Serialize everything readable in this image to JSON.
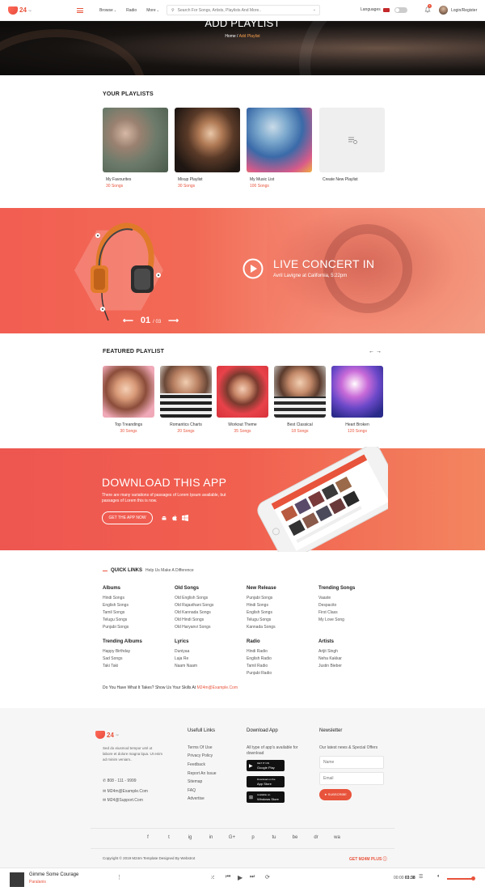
{
  "header": {
    "logo_text": "24",
    "logo_sub": "mp",
    "nav": [
      "Browse",
      "Radio",
      "More"
    ],
    "search_placeholder": "Search For Songs, Artists, Playlists And More..",
    "language_label": "Languages",
    "notification_count": "2",
    "login_label": "Login/Register"
  },
  "hero": {
    "title": "ADD PLAYLIST",
    "breadcrumb_home": "Home",
    "breadcrumb_sep": "/",
    "breadcrumb_current": "Add Playlist"
  },
  "your_playlists": {
    "heading": "YOUR PLAYLISTS",
    "items": [
      {
        "name": "My Favourites",
        "count": "30 Songs"
      },
      {
        "name": "Mixup Playlist",
        "count": "30 Songs"
      },
      {
        "name": "My Music List",
        "count": "100 Songs"
      },
      {
        "name": "Create New Playlist",
        "count": ""
      }
    ]
  },
  "concert": {
    "title": "LIVE CONCERT IN",
    "subtitle": "Avril Lavigne at California, 5:22pm",
    "slide_current": "01",
    "slide_total": "/ 03"
  },
  "featured": {
    "heading": "FEATURED PLAYLIST",
    "items": [
      {
        "name": "Top Treandings",
        "count": "30 Songs"
      },
      {
        "name": "Romantics Charts",
        "count": "20 Songs"
      },
      {
        "name": "Workout Theme",
        "count": "35 Songs"
      },
      {
        "name": "Best Classical",
        "count": "18 Songs"
      },
      {
        "name": "Heart Broken",
        "count": "120 Songs"
      }
    ]
  },
  "download": {
    "title": "DOWNLOAD THIS APP",
    "text": "There are many variations of passages of Lorem Ipsum available, but passages of Lorem this is now.",
    "button": "GET THE APP NOW"
  },
  "quick_links": {
    "title": "QUICK LINKS",
    "desc": "Help Us Make A Difference",
    "columns": [
      {
        "title": "Albums",
        "links": [
          "Hindi Songs",
          "English Songs",
          "Tamil Songs",
          "Telugu Songs",
          "Punjabi Songs"
        ]
      },
      {
        "title": "Old Songs",
        "links": [
          "Old English Songs",
          "Old Rajasthani Songs",
          "Old Kannada Songs",
          "Old Hindi Songs",
          "Old Haryanvi Songs"
        ]
      },
      {
        "title": "New Release",
        "links": [
          "Punjabi Songs",
          "Hindi Songs",
          "English Songs",
          "Telugu Songs",
          "Kannada Songs"
        ]
      },
      {
        "title": "Trending Songs",
        "links": [
          "Vaaste",
          "Despacito",
          "First Class",
          "My Love Song"
        ]
      },
      {
        "title": "Trending Albums",
        "links": [
          "Happy Birthday",
          "Sad Songs",
          "Taki Taki"
        ]
      },
      {
        "title": "Lyrics",
        "links": [
          "Duniyaa",
          "Laja Re",
          "Naam Naam"
        ]
      },
      {
        "title": "Radio",
        "links": [
          "Hindi Radio",
          "English Radio",
          "Tamil Radio",
          "Punjabi Radio"
        ]
      },
      {
        "title": "Artists",
        "links": [
          "Arijit Singh",
          "Neha Kakkar",
          "Justin Bieber"
        ]
      }
    ],
    "challenge_text": "Do You Have What It Takes? Show Us Your Skills At",
    "challenge_email": "M24m@Example.Com"
  },
  "footer": {
    "about": "Sed do eiusmod tempor uml ut labore et dolore magna lqua. Ut enim ad minim veniam..",
    "phone": "808 - 111 - 9999",
    "email1": "M24m@Example.Com",
    "email2": "M24@Support.Com",
    "useful_title": "Usefull Links",
    "useful_links": [
      "Terms Of Use",
      "Privacy Policy",
      "Feedback",
      "Report An Issue",
      "Sitemap",
      "FAQ",
      "Advertise"
    ],
    "download_title": "Download App",
    "download_text": "All type of app's available for download",
    "stores": [
      {
        "small": "GET IT ON",
        "big": "Google Play"
      },
      {
        "small": "Download on the",
        "big": "App Store"
      },
      {
        "small": "Available on",
        "big": "Windows Store"
      }
    ],
    "newsletter_title": "Newsletter",
    "newsletter_text": "Our latest news & Special Offers",
    "name_placeholder": "Name",
    "email_placeholder": "Email",
    "subscribe": "SUBSCRIBE",
    "social": [
      "f",
      "t",
      "ig",
      "in",
      "G+",
      "p",
      "tu",
      "be",
      "dr",
      "wa"
    ],
    "copyright": "Copyright © 2019 M24m Template Designed By  Webstrot",
    "get_plus": "GET M24M PLUS"
  },
  "player": {
    "song": "Gimme Some Courage",
    "artist": "Paralanis",
    "time_current": "00:00",
    "time_total": "03:38",
    "volume": 0.85
  },
  "colors": {
    "accent": "#e8533b",
    "banner": "#f26a55"
  }
}
